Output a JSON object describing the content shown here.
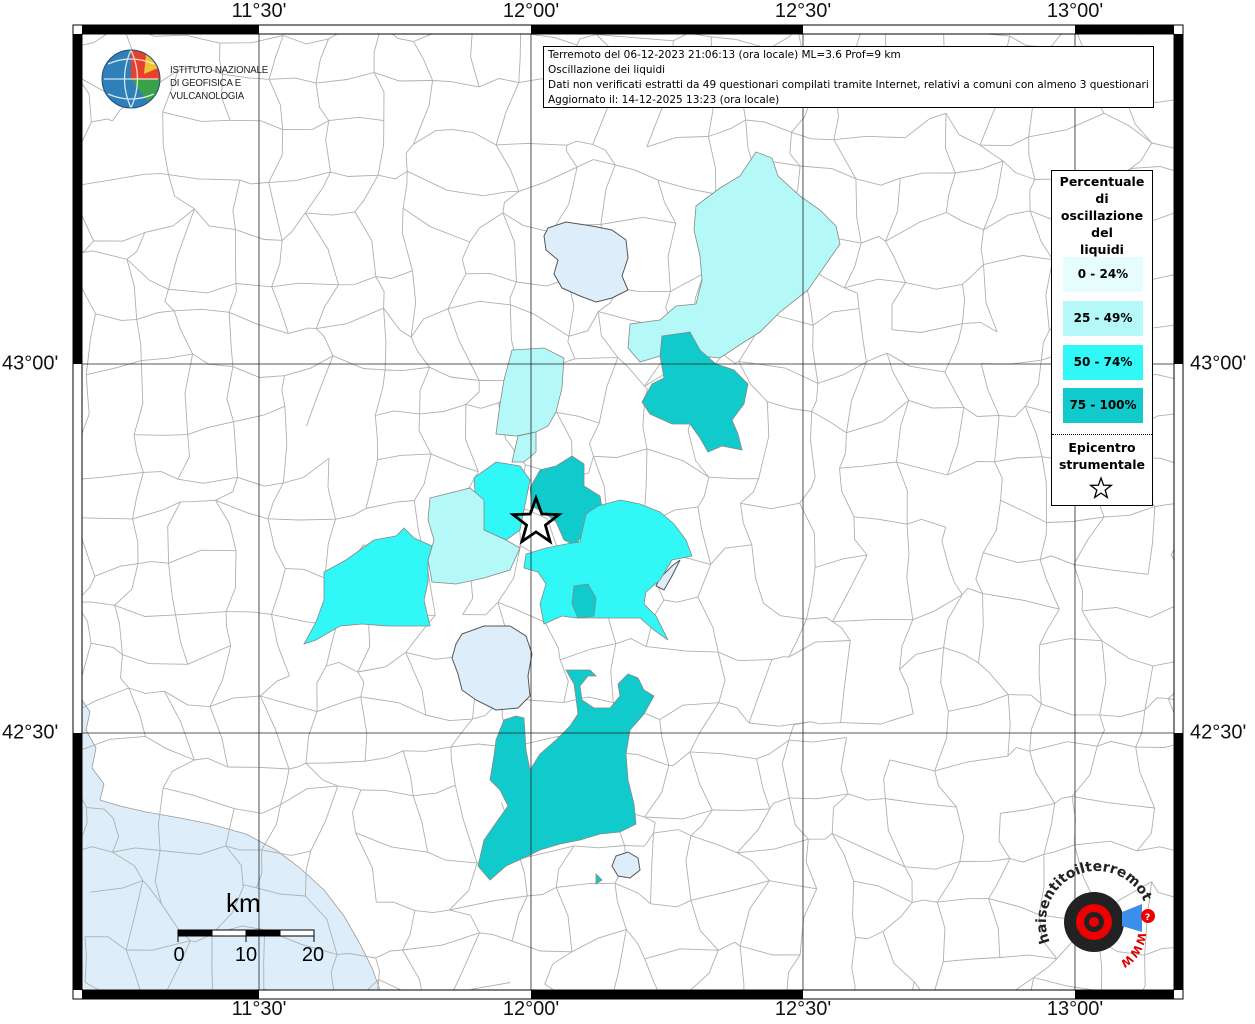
{
  "map": {
    "ticks": {
      "longitudes": [
        "11°30'",
        "12°00'",
        "12°30'",
        "13°00'"
      ],
      "latitudes": [
        "43°00'",
        "42°30'"
      ]
    },
    "colors": {
      "sea": "#ddeefa",
      "lake": "#ddeefa",
      "land": "#ffffff",
      "boundary": "#a9a9a9",
      "class_0_24": "#e6fdfd",
      "class_25_49": "#b4f8f8",
      "class_50_74": "#31f7f7",
      "class_75_100": "#11cacc"
    }
  },
  "logo": {
    "name": "ingv-globe-icon",
    "line1": "ISTITUTO NAZIONALE",
    "line2": "DI GEOFISICA E VULCANOLOGIA"
  },
  "info": {
    "line1": "Terremoto del 06-12-2023 21:06:13 (ora locale) ML=3.6 Prof=9 km",
    "line2": "Oscillazione dei liquidi",
    "line3": "Dati non verificati estratti da 49 questionari compilati tramite Internet, relativi a comuni con almeno 3 questionari.",
    "line4": "Aggiornato il: 14-12-2025 13:23 (ora locale)"
  },
  "legend": {
    "title_lines": [
      "Percentuale",
      "di",
      "oscillazione",
      "del",
      "liquidi"
    ],
    "items": [
      {
        "label": "0 - 24%",
        "color": "#e6fdfd"
      },
      {
        "label": "25 - 49%",
        "color": "#b4f8f8"
      },
      {
        "label": "50 - 74%",
        "color": "#31f7f7"
      },
      {
        "label": "75 - 100%",
        "color": "#11cacc"
      }
    ],
    "epicenter_lines": [
      "Epicentro",
      "strumentale"
    ],
    "epicenter_icon": "star-icon"
  },
  "scale": {
    "title": "km",
    "labels": [
      "0",
      "10",
      "20"
    ]
  },
  "brand": {
    "name": "haisentitoilterremoto-logo",
    "text_outer": "haisentitoilterremoto.it",
    "text_inner": "WWW"
  }
}
